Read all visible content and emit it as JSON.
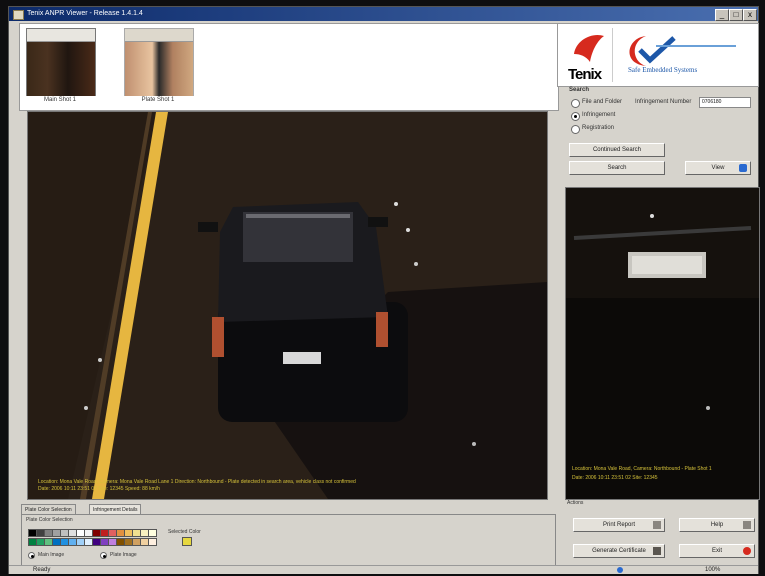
{
  "window": {
    "title": "Tenix ANPR Viewer - Release 1.4.1.4",
    "minimize": "_",
    "maximize": "□",
    "close": "x"
  },
  "thumbnails": [
    {
      "label": "Main Shot 1"
    },
    {
      "label": "Plate Shot 1"
    }
  ],
  "main_image": {
    "overlay_line1": "Location: Mona Vale Road, Camera: Mona Vale Road Lane 1 Direction: Northbound - Plate detected in search area, vehicle class not confirmed",
    "overlay_line2": "Date: 2006 10:11 23:51 02 Site: 12345 Speed: 88 km/h"
  },
  "logos": {
    "tenix": "Tenix",
    "ses": "Safe Embedded Systems"
  },
  "search": {
    "heading": "Search",
    "options": [
      {
        "label": "File and Folder",
        "selected": false
      },
      {
        "label": "Infringement",
        "selected": true
      },
      {
        "label": "Registration",
        "selected": false
      }
    ],
    "infringement_label": "Infringement Number",
    "infringement_value": "0706180",
    "buttons": {
      "cont_search": "Continued Search",
      "search": "Search",
      "view": "View"
    }
  },
  "plate_image": {
    "overlay_line1": "Location: Mona Vale Road, Camera: Northbound - Plate Shot 1",
    "overlay_line2": "Date: 2006 10:11 23:51 02 Site: 12345"
  },
  "bottom_tabs": {
    "tabs": [
      "Plate Color Selection",
      "Infringement Details"
    ],
    "legend": "Plate Color Selection",
    "selected_color_label": "Selected Color",
    "checkbox_main": "Main Image",
    "checkbox_plate": "Plate Image",
    "swatch_colors": [
      "#000000",
      "#404040",
      "#808080",
      "#a0a0a0",
      "#c0c0c0",
      "#e0e0e0",
      "#ffffff",
      "#f4f4f4",
      "#800000",
      "#c02020",
      "#e06060",
      "#e09040",
      "#f0c060",
      "#f0e090",
      "#f8f0c0",
      "#ffffe0",
      "#008040",
      "#20a060",
      "#60c080",
      "#0070c0",
      "#2090e0",
      "#60b0f0",
      "#a0d0f8",
      "#e0f0ff",
      "#400080",
      "#8040c0",
      "#c080e0",
      "#805000",
      "#a07020",
      "#d0a060",
      "#f0d0a0",
      "#fff0e0"
    ]
  },
  "actions": {
    "heading": "Actions",
    "print_report": "Print Report",
    "help": "Help",
    "generate_certificate": "Generate Certificate",
    "exit": "Exit"
  },
  "status": {
    "left": "Ready",
    "right": "100%"
  },
  "colors": {
    "accent": "#1d57a8",
    "overlay_text": "#d6c23a",
    "tenix_red": "#d62a1e"
  }
}
